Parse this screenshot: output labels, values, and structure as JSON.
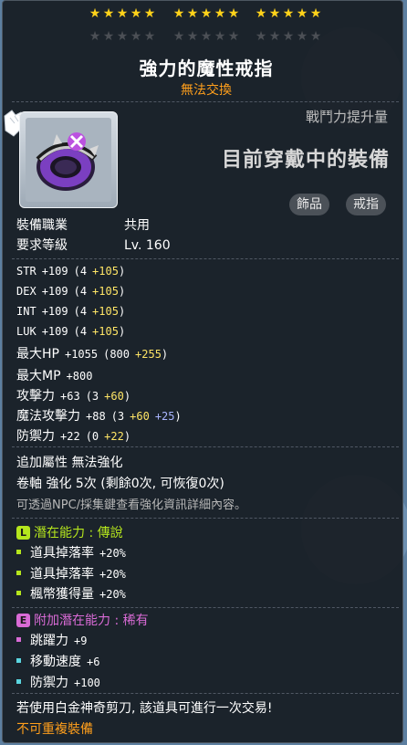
{
  "stars": {
    "filled": 15,
    "total": 25
  },
  "item": {
    "name": "強力的魔性戒指",
    "trade_status": "無法交換",
    "combat_power_label": "戰鬥力提升量",
    "equipped_label": "目前穿戴中的裝備",
    "tags": [
      "飾品",
      "戒指"
    ],
    "icon": "ring-icon"
  },
  "requirements": {
    "job_label": "裝備職業",
    "job_value": "共用",
    "level_label": "要求等級",
    "level_value": "Lv. 160"
  },
  "stats": [
    {
      "label": "STR",
      "total": "+109",
      "base": "(4",
      "bonus": "+105",
      "bonus2": "",
      "close": ")"
    },
    {
      "label": "DEX",
      "total": "+109",
      "base": "(4",
      "bonus": "+105",
      "bonus2": "",
      "close": ")"
    },
    {
      "label": "INT",
      "total": "+109",
      "base": "(4",
      "bonus": "+105",
      "bonus2": "",
      "close": ")"
    },
    {
      "label": "LUK",
      "total": "+109",
      "base": "(4",
      "bonus": "+105",
      "bonus2": "",
      "close": ")"
    },
    {
      "label": "最大HP",
      "total": "+1055",
      "base": "(800",
      "bonus": "+255",
      "bonus2": "",
      "close": ")"
    },
    {
      "label": "最大MP",
      "total": "+800",
      "base": "",
      "bonus": "",
      "bonus2": "",
      "close": ""
    },
    {
      "label": "攻擊力",
      "total": "+63",
      "base": "(3",
      "bonus": "+60",
      "bonus2": "",
      "close": ")"
    },
    {
      "label": "魔法攻擊力",
      "total": "+88",
      "base": "(3",
      "bonus": "+60",
      "bonus2": "+25",
      "close": ")"
    },
    {
      "label": "防禦力",
      "total": "+22",
      "base": "(0",
      "bonus": "+22",
      "bonus2": "",
      "close": ")"
    }
  ],
  "extra": {
    "attr_label": "追加屬性",
    "attr_value": "無法強化",
    "scroll_label": "卷軸",
    "scroll_value": "強化 5次 (剩餘0次, 可恢復0次)",
    "hint": "可透過NPC/採集鍵查看強化資訊詳細內容。"
  },
  "potential": {
    "badge": "L",
    "title": "潛在能力 : 傳說",
    "color": "#b5e61d",
    "lines": [
      {
        "name": "道具掉落率",
        "value": "+20%"
      },
      {
        "name": "道具掉落率",
        "value": "+20%"
      },
      {
        "name": "楓幣獲得量",
        "value": "+20%"
      }
    ]
  },
  "additional_potential": {
    "badge": "E",
    "title": "附加潛在能力 : 稀有",
    "color": "#d96bd6",
    "bullet_color": "#5bd6e0",
    "lines": [
      {
        "name": "跳躍力",
        "value": "+9"
      },
      {
        "name": "移動速度",
        "value": "+6"
      },
      {
        "name": "防禦力",
        "value": "+100"
      }
    ]
  },
  "footer": {
    "scissors_note": "若使用白金神奇剪刀, 該道具可進行一次交易!",
    "no_duplicate": "不可重複裝備"
  }
}
